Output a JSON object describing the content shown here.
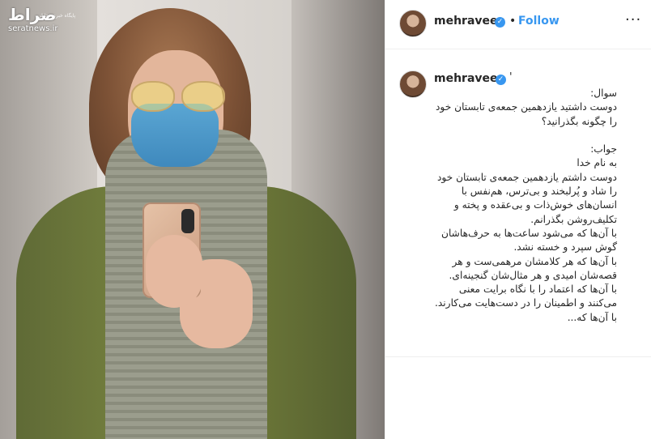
{
  "watermark": {
    "logo": "صراط",
    "subtitle": "پایگاه خبری تحلیلی",
    "site": "seratnews.ir"
  },
  "post": {
    "header": {
      "username": "mehraveee",
      "separator": "•",
      "follow_label": "Follow",
      "more_icon": "more-horizontal-icon",
      "more_label": "···"
    },
    "caption": {
      "username": "mehraveee",
      "tick": "'",
      "text": "سوال:\nدوست داشتید یازدهمین جمعه‌ی تابستان خود را چگونه بگذرانید؟\n\nجواب:\nبه نام خدا\nدوست داشتم یازدهمین جمعه‌ی تابستان خود را شاد و پُرلبخند و بی‌ترس، هم‌نفس با انسان‌های خوش‌ذات و بی‌عقده و پخته و تکلیف‌روشن بگذرانم.\nبا آن‌ها که می‌شود ساعت‌ها به حرف‌هاشان گوش سپرد و خسته نشد.\nبا آن‌ها که هر کلامشان مرهمی‌ست و هر قصه‌شان امیدی و هر مثال‌شان گنجینه‌ای.\nبا آن‌ها که اعتماد را با نگاه برایت معنی می‌کنند و اطمینان را در دست‌هایت می‌کارند.\nبا آن‌ها که..."
    }
  },
  "colors": {
    "accent": "#3897f0",
    "text": "#262626",
    "border": "#efefef"
  }
}
